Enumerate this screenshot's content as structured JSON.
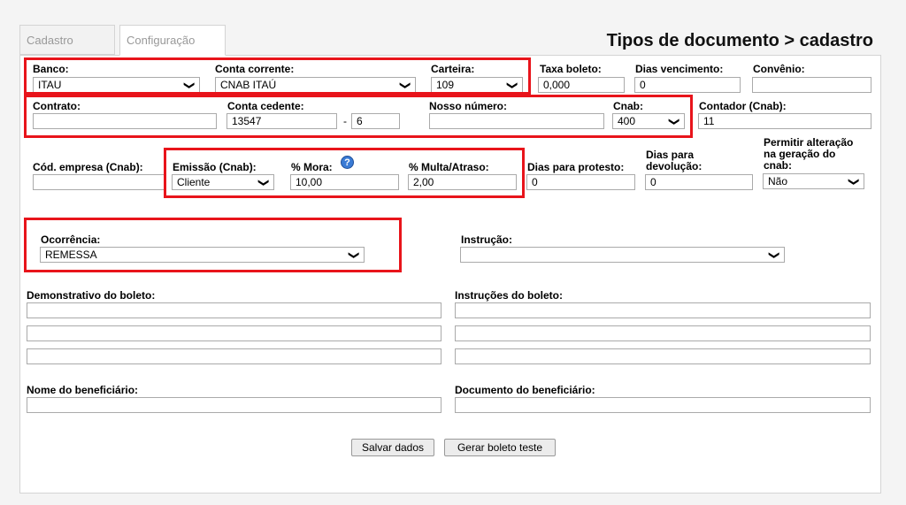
{
  "tabs": [
    "Cadastro",
    "Configuração"
  ],
  "title": "Tipos de documento > cadastro",
  "banco": {
    "label": "Banco:",
    "value": "ITAU"
  },
  "conta_corrente": {
    "label": "Conta corrente:",
    "value": "CNAB ITAÚ"
  },
  "carteira": {
    "label": "Carteira:",
    "value": "109"
  },
  "taxa_boleto": {
    "label": "Taxa boleto:",
    "value": "0,000"
  },
  "dias_vencimento": {
    "label": "Dias vencimento:",
    "value": "0"
  },
  "convenio": {
    "label": "Convênio:",
    "value": ""
  },
  "contrato": {
    "label": "Contrato:",
    "value": ""
  },
  "conta_cedente": {
    "label": "Conta cedente:",
    "value": "13547",
    "separator": "-",
    "digit": "6"
  },
  "nosso_numero": {
    "label": "Nosso número:",
    "value": ""
  },
  "cnab": {
    "label": "Cnab:",
    "value": "400"
  },
  "contador_cnab": {
    "label": "Contador (Cnab):",
    "value": "11"
  },
  "cod_empresa": {
    "label": "Cód. empresa (Cnab):",
    "value": ""
  },
  "emissao": {
    "label": "Emissão (Cnab):",
    "value": "Cliente"
  },
  "mora": {
    "label": "% Mora:",
    "value": "10,00",
    "help_icon": "question-circle-icon",
    "help_text": "?"
  },
  "multa": {
    "label": "% Multa/Atraso:",
    "value": "2,00"
  },
  "dias_protesto": {
    "label": "Dias para protesto:",
    "value": "0"
  },
  "dias_devolucao": {
    "label_line1": "Dias para",
    "label_line2": "devolução:",
    "value": "0"
  },
  "permitir": {
    "label_line1": "Permitir alteração",
    "label_line2": "na geração do",
    "label_line3": "cnab:",
    "value": "Não"
  },
  "ocorrencia": {
    "label": "Ocorrência:",
    "value": "REMESSA"
  },
  "instrucao": {
    "label": "Instrução:",
    "value": ""
  },
  "demonstrativo": {
    "label": "Demonstrativo do boleto:",
    "lines": [
      "",
      "",
      ""
    ]
  },
  "instrucoes_boleto": {
    "label": "Instruções do boleto:",
    "lines": [
      "",
      "",
      ""
    ]
  },
  "nome_beneficiario": {
    "label": "Nome do beneficiário:",
    "value": ""
  },
  "documento_beneficiario": {
    "label": "Documento do beneficiário:",
    "value": ""
  },
  "buttons": {
    "save": "Salvar dados",
    "test": "Gerar boleto teste"
  },
  "dropdown_arrow": "❯",
  "highlight_color": "#e8141b"
}
